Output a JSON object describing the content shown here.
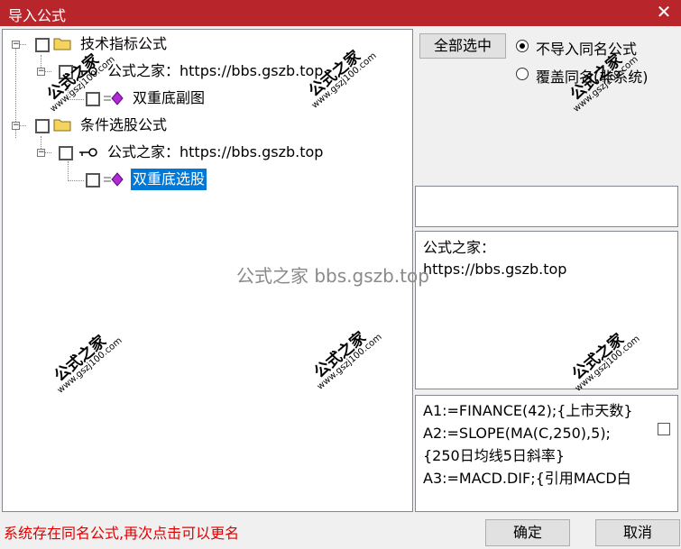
{
  "window": {
    "title": "导入公式",
    "close_glyph": "✕"
  },
  "tree": {
    "nodes": [
      {
        "label": "技术指标公式",
        "icon": "folder-icon"
      },
      {
        "label": "公式之家：https://bbs.gszb.top",
        "icon": "key-icon"
      },
      {
        "label": "双重底副图",
        "icon": "formula-gem-icon"
      },
      {
        "label": "条件选股公式",
        "icon": "folder-icon"
      },
      {
        "label": "公式之家：https://bbs.gszb.top",
        "icon": "key-icon"
      },
      {
        "label": "双重底选股",
        "icon": "formula-gem-icon",
        "selected": true
      }
    ]
  },
  "options": {
    "select_all_label": "全部选中",
    "radio_no_import": "不导入同名公式",
    "radio_overwrite": "覆盖同名(非系统)",
    "selected_radio": "no_import"
  },
  "info": {
    "line1": "公式之家：",
    "line2": "https://bbs.gszb.top"
  },
  "code": {
    "lines": [
      "A1:=FINANCE(42);{上市天数}",
      "A2:=SLOPE(MA(C,250),5);",
      "{250日均线5日斜率}",
      "A3:=MACD.DIF;{引用MACD白"
    ]
  },
  "status_text": "系统存在同名公式,再次点击可以更名",
  "buttons": {
    "ok": "确定",
    "cancel": "取消"
  },
  "watermark": {
    "center": "公式之家 bbs.gszb.top",
    "stamp_big": "公式之家",
    "stamp_small": "www.gszj100.com"
  }
}
